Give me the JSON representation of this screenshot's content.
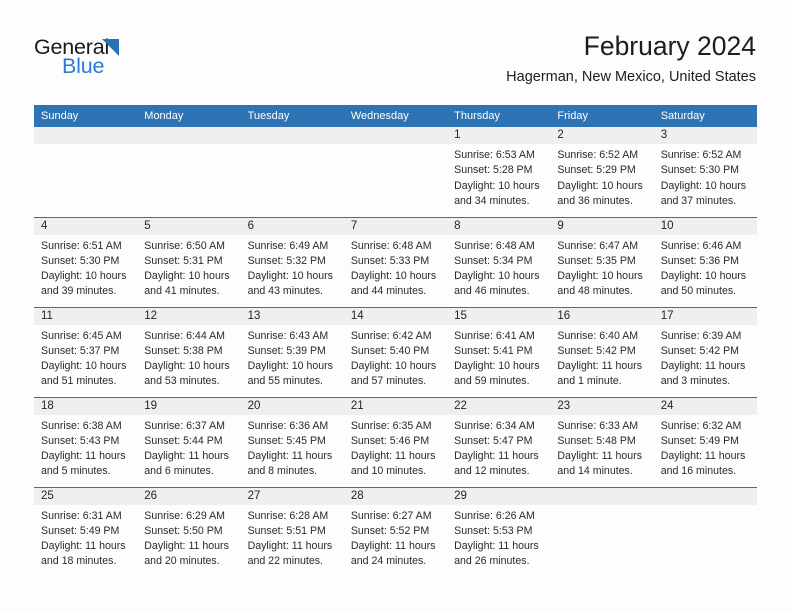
{
  "brand": {
    "name_part1": "General",
    "name_part2": "Blue",
    "accent_color": "#2b7bd4",
    "triangle_color": "#2b72b4",
    "logo_icon": "blue-triangle-icon"
  },
  "header": {
    "month_title": "February 2024",
    "location": "Hagerman, New Mexico, United States"
  },
  "theme": {
    "header_blue": "#2e74b5",
    "daynum_band_gray": "#efefef",
    "cell_background": "#fdfdfd",
    "text_color": "#2a2a2a"
  },
  "weekday_headers": [
    "Sunday",
    "Monday",
    "Tuesday",
    "Wednesday",
    "Thursday",
    "Friday",
    "Saturday"
  ],
  "calendar": {
    "weeks": [
      [
        {
          "day": "",
          "sunrise": "",
          "sunset": "",
          "daylight_line1": "",
          "daylight_line2": ""
        },
        {
          "day": "",
          "sunrise": "",
          "sunset": "",
          "daylight_line1": "",
          "daylight_line2": ""
        },
        {
          "day": "",
          "sunrise": "",
          "sunset": "",
          "daylight_line1": "",
          "daylight_line2": ""
        },
        {
          "day": "",
          "sunrise": "",
          "sunset": "",
          "daylight_line1": "",
          "daylight_line2": ""
        },
        {
          "day": "1",
          "sunrise": "Sunrise: 6:53 AM",
          "sunset": "Sunset: 5:28 PM",
          "daylight_line1": "Daylight: 10 hours",
          "daylight_line2": "and 34 minutes."
        },
        {
          "day": "2",
          "sunrise": "Sunrise: 6:52 AM",
          "sunset": "Sunset: 5:29 PM",
          "daylight_line1": "Daylight: 10 hours",
          "daylight_line2": "and 36 minutes."
        },
        {
          "day": "3",
          "sunrise": "Sunrise: 6:52 AM",
          "sunset": "Sunset: 5:30 PM",
          "daylight_line1": "Daylight: 10 hours",
          "daylight_line2": "and 37 minutes."
        }
      ],
      [
        {
          "day": "4",
          "sunrise": "Sunrise: 6:51 AM",
          "sunset": "Sunset: 5:30 PM",
          "daylight_line1": "Daylight: 10 hours",
          "daylight_line2": "and 39 minutes."
        },
        {
          "day": "5",
          "sunrise": "Sunrise: 6:50 AM",
          "sunset": "Sunset: 5:31 PM",
          "daylight_line1": "Daylight: 10 hours",
          "daylight_line2": "and 41 minutes."
        },
        {
          "day": "6",
          "sunrise": "Sunrise: 6:49 AM",
          "sunset": "Sunset: 5:32 PM",
          "daylight_line1": "Daylight: 10 hours",
          "daylight_line2": "and 43 minutes."
        },
        {
          "day": "7",
          "sunrise": "Sunrise: 6:48 AM",
          "sunset": "Sunset: 5:33 PM",
          "daylight_line1": "Daylight: 10 hours",
          "daylight_line2": "and 44 minutes."
        },
        {
          "day": "8",
          "sunrise": "Sunrise: 6:48 AM",
          "sunset": "Sunset: 5:34 PM",
          "daylight_line1": "Daylight: 10 hours",
          "daylight_line2": "and 46 minutes."
        },
        {
          "day": "9",
          "sunrise": "Sunrise: 6:47 AM",
          "sunset": "Sunset: 5:35 PM",
          "daylight_line1": "Daylight: 10 hours",
          "daylight_line2": "and 48 minutes."
        },
        {
          "day": "10",
          "sunrise": "Sunrise: 6:46 AM",
          "sunset": "Sunset: 5:36 PM",
          "daylight_line1": "Daylight: 10 hours",
          "daylight_line2": "and 50 minutes."
        }
      ],
      [
        {
          "day": "11",
          "sunrise": "Sunrise: 6:45 AM",
          "sunset": "Sunset: 5:37 PM",
          "daylight_line1": "Daylight: 10 hours",
          "daylight_line2": "and 51 minutes."
        },
        {
          "day": "12",
          "sunrise": "Sunrise: 6:44 AM",
          "sunset": "Sunset: 5:38 PM",
          "daylight_line1": "Daylight: 10 hours",
          "daylight_line2": "and 53 minutes."
        },
        {
          "day": "13",
          "sunrise": "Sunrise: 6:43 AM",
          "sunset": "Sunset: 5:39 PM",
          "daylight_line1": "Daylight: 10 hours",
          "daylight_line2": "and 55 minutes."
        },
        {
          "day": "14",
          "sunrise": "Sunrise: 6:42 AM",
          "sunset": "Sunset: 5:40 PM",
          "daylight_line1": "Daylight: 10 hours",
          "daylight_line2": "and 57 minutes."
        },
        {
          "day": "15",
          "sunrise": "Sunrise: 6:41 AM",
          "sunset": "Sunset: 5:41 PM",
          "daylight_line1": "Daylight: 10 hours",
          "daylight_line2": "and 59 minutes."
        },
        {
          "day": "16",
          "sunrise": "Sunrise: 6:40 AM",
          "sunset": "Sunset: 5:42 PM",
          "daylight_line1": "Daylight: 11 hours",
          "daylight_line2": "and 1 minute."
        },
        {
          "day": "17",
          "sunrise": "Sunrise: 6:39 AM",
          "sunset": "Sunset: 5:42 PM",
          "daylight_line1": "Daylight: 11 hours",
          "daylight_line2": "and 3 minutes."
        }
      ],
      [
        {
          "day": "18",
          "sunrise": "Sunrise: 6:38 AM",
          "sunset": "Sunset: 5:43 PM",
          "daylight_line1": "Daylight: 11 hours",
          "daylight_line2": "and 5 minutes."
        },
        {
          "day": "19",
          "sunrise": "Sunrise: 6:37 AM",
          "sunset": "Sunset: 5:44 PM",
          "daylight_line1": "Daylight: 11 hours",
          "daylight_line2": "and 6 minutes."
        },
        {
          "day": "20",
          "sunrise": "Sunrise: 6:36 AM",
          "sunset": "Sunset: 5:45 PM",
          "daylight_line1": "Daylight: 11 hours",
          "daylight_line2": "and 8 minutes."
        },
        {
          "day": "21",
          "sunrise": "Sunrise: 6:35 AM",
          "sunset": "Sunset: 5:46 PM",
          "daylight_line1": "Daylight: 11 hours",
          "daylight_line2": "and 10 minutes."
        },
        {
          "day": "22",
          "sunrise": "Sunrise: 6:34 AM",
          "sunset": "Sunset: 5:47 PM",
          "daylight_line1": "Daylight: 11 hours",
          "daylight_line2": "and 12 minutes."
        },
        {
          "day": "23",
          "sunrise": "Sunrise: 6:33 AM",
          "sunset": "Sunset: 5:48 PM",
          "daylight_line1": "Daylight: 11 hours",
          "daylight_line2": "and 14 minutes."
        },
        {
          "day": "24",
          "sunrise": "Sunrise: 6:32 AM",
          "sunset": "Sunset: 5:49 PM",
          "daylight_line1": "Daylight: 11 hours",
          "daylight_line2": "and 16 minutes."
        }
      ],
      [
        {
          "day": "25",
          "sunrise": "Sunrise: 6:31 AM",
          "sunset": "Sunset: 5:49 PM",
          "daylight_line1": "Daylight: 11 hours",
          "daylight_line2": "and 18 minutes."
        },
        {
          "day": "26",
          "sunrise": "Sunrise: 6:29 AM",
          "sunset": "Sunset: 5:50 PM",
          "daylight_line1": "Daylight: 11 hours",
          "daylight_line2": "and 20 minutes."
        },
        {
          "day": "27",
          "sunrise": "Sunrise: 6:28 AM",
          "sunset": "Sunset: 5:51 PM",
          "daylight_line1": "Daylight: 11 hours",
          "daylight_line2": "and 22 minutes."
        },
        {
          "day": "28",
          "sunrise": "Sunrise: 6:27 AM",
          "sunset": "Sunset: 5:52 PM",
          "daylight_line1": "Daylight: 11 hours",
          "daylight_line2": "and 24 minutes."
        },
        {
          "day": "29",
          "sunrise": "Sunrise: 6:26 AM",
          "sunset": "Sunset: 5:53 PM",
          "daylight_line1": "Daylight: 11 hours",
          "daylight_line2": "and 26 minutes."
        },
        {
          "day": "",
          "sunrise": "",
          "sunset": "",
          "daylight_line1": "",
          "daylight_line2": ""
        },
        {
          "day": "",
          "sunrise": "",
          "sunset": "",
          "daylight_line1": "",
          "daylight_line2": ""
        }
      ]
    ]
  }
}
